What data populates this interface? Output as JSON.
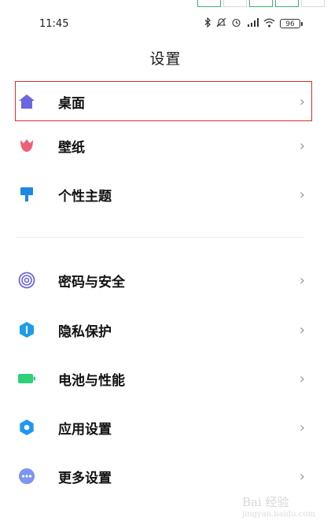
{
  "status_bar": {
    "time": "11:45",
    "battery": "96",
    "icons": [
      "bluetooth-icon",
      "do-not-disturb-icon",
      "alarm-icon",
      "signal-hd-icon",
      "wifi-icon",
      "battery-icon"
    ]
  },
  "page": {
    "title": "设置"
  },
  "group1": [
    {
      "label": "桌面",
      "icon": "home-icon",
      "color": "#6c66e0"
    },
    {
      "label": "壁纸",
      "icon": "tulip-icon",
      "color": "#ee5f7a"
    },
    {
      "label": "个性主题",
      "icon": "paintbrush-icon",
      "color": "#1e88e5"
    }
  ],
  "group2": [
    {
      "label": "密码与安全",
      "icon": "fingerprint-icon",
      "color": "#6b66d4"
    },
    {
      "label": "隐私保护",
      "icon": "privacy-shield-icon",
      "color": "#1e9ce8"
    },
    {
      "label": "电池与性能",
      "icon": "battery-icon",
      "color": "#2fd07a"
    },
    {
      "label": "应用设置",
      "icon": "gear-icon",
      "color": "#2196f3"
    },
    {
      "label": "更多设置",
      "icon": "more-icon",
      "color": "#7d95f0"
    }
  ],
  "chevron": "›",
  "watermark": {
    "text": "Bai 经验",
    "sub": "jingyan.baidu.com"
  }
}
